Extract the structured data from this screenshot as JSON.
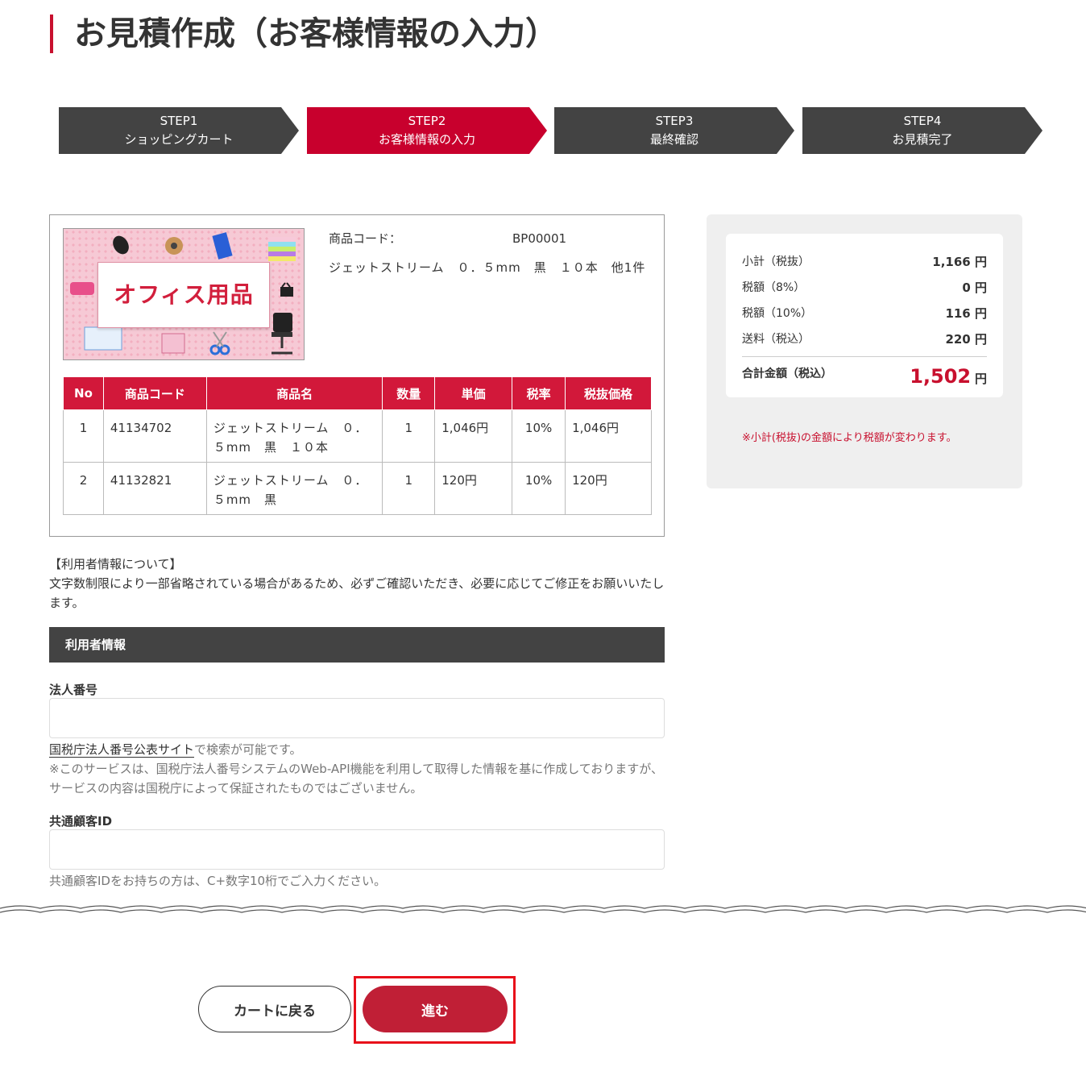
{
  "page_title": "お見積作成（お客様情報の入力）",
  "steps": [
    {
      "num": "STEP1",
      "label": "ショッピングカート"
    },
    {
      "num": "STEP2",
      "label": "お客様情報の入力"
    },
    {
      "num": "STEP3",
      "label": "最終確認"
    },
    {
      "num": "STEP4",
      "label": "お見積完了"
    }
  ],
  "product": {
    "banner_text": "オフィス用品",
    "code_label": "商品コード：",
    "code": "BP00001",
    "name": "ジェットストリーム　０．５mm　黒　１０本　他1件"
  },
  "table": {
    "headers": [
      "No",
      "商品コード",
      "商品名",
      "数量",
      "単価",
      "税率",
      "税抜価格"
    ],
    "rows": [
      {
        "no": "1",
        "code": "41134702",
        "name": "ジェットストリーム　０．５mm　黒　１０本",
        "qty": "1",
        "price": "1,046円",
        "tax": "10%",
        "subtotal": "1,046円"
      },
      {
        "no": "2",
        "code": "41132821",
        "name": "ジェットストリーム　０．５mm　黒",
        "qty": "1",
        "price": "120円",
        "tax": "10%",
        "subtotal": "120円"
      }
    ]
  },
  "summary": {
    "subtotal_label": "小計（税抜）",
    "subtotal": "1,166",
    "tax8_label": "税額（8%）",
    "tax8": "0",
    "tax10_label": "税額（10%）",
    "tax10": "116",
    "shipping_label": "送料（税込）",
    "shipping": "220",
    "total_label": "合計金額（税込）",
    "total": "1,502",
    "yen": "円",
    "note": "※小計(税抜)の金額により税額が変わります。"
  },
  "notice": {
    "title": "【利用者情報について】",
    "body": "文字数制限により一部省略されている場合があるため、必ずご確認いただき、必要に応じてご修正をお願いいたします。"
  },
  "section_title": "利用者情報",
  "fields": {
    "corp_number_label": "法人番号",
    "corp_number_value": "",
    "corp_link": "国税庁法人番号公表サイト",
    "corp_link_suffix": "で検索が可能です。",
    "corp_disclaimer": "※このサービスは、国税庁法人番号システムのWeb-API機能を利用して取得した情報を基に作成しておりますが、サービスの内容は国税庁によって保証されたものではございません。",
    "customer_id_label": "共通顧客ID",
    "customer_id_value": "",
    "customer_id_help": "共通顧客IDをお持ちの方は、C+数字10桁でご入力ください。"
  },
  "buttons": {
    "back": "カートに戻る",
    "next": "進む"
  },
  "colors": {
    "accent": "#c8102e",
    "step_active": "#c8002d",
    "step_dark": "#434343",
    "table_header": "#d2183a",
    "highlight": "#e8101a"
  }
}
